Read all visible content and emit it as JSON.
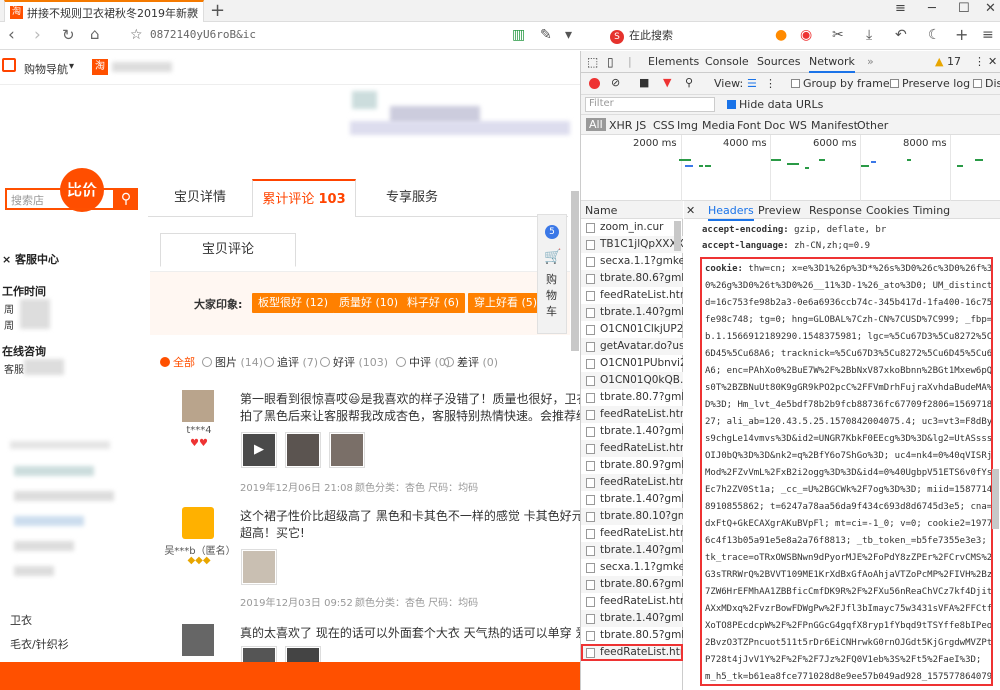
{
  "browser": {
    "tab_title": "拼接不规则卫衣裙秋冬2019年新款",
    "tab_close": "✕",
    "new_tab": "+",
    "url": "0872140yU6roB&ic",
    "search_engine_label": "在此搜索",
    "window_controls": [
      "≡",
      "─",
      "☐",
      "✕"
    ]
  },
  "shop": {
    "nav_label": "购物导航",
    "nav_arrow": "▾",
    "bijia": "比价",
    "search_placeholder": "搜索店",
    "side": {
      "service_center": "客服中心",
      "work_time": "工作时间",
      "work_time_line1": "周",
      "work_time_line2": "周",
      "online": "在线咨询",
      "online_sub": "客服",
      "cat_women": "卫衣",
      "cat_sweater": "毛衣/针织衫"
    },
    "tabs": [
      {
        "label": "宝贝详情",
        "count": ""
      },
      {
        "label": "累计评论",
        "count": "103"
      },
      {
        "label": "专享服务",
        "count": ""
      }
    ],
    "subtab": "宝贝评论",
    "impression_label": "大家印象:",
    "impression_tags": [
      "板型很好 (12)",
      "质量好 (10)",
      "料子好 (6)",
      "穿上好看 (5)"
    ],
    "filters": [
      {
        "label": "全部",
        "count": ""
      },
      {
        "label": "图片",
        "count": "(14)"
      },
      {
        "label": "追评",
        "count": "(7)"
      },
      {
        "label": "好评",
        "count": "(103)"
      },
      {
        "label": "中评",
        "count": "(0)"
      },
      {
        "label": "差评",
        "count": "(0)"
      }
    ],
    "reviews": [
      {
        "user": "t***4",
        "badge": "♥♥",
        "text": "第一眼看到很惊喜哎😃是我喜欢的样子没错了！质量也很好，卫衣",
        "text2": "拍了黑色后来让客服帮我改成杏色，客服特别热情快速。会推荐给",
        "date": "2019年12月06日 21:08",
        "attr": "颜色分类：杏色  尺码：均码"
      },
      {
        "user": "吴***b（匿名）",
        "badge": "◆◆◆",
        "text": "这个裙子性价比超级高了 黑色和卡其色不一样的感觉 卡其色好元气",
        "text2": "超高！买它!",
        "date": "2019年12月03日 09:52",
        "attr": "颜色分类：杏色  尺码：均码"
      },
      {
        "user": "",
        "badge": "",
        "text": "真的太喜欢了 现在的话可以外面套个大衣 天气热的话可以单穿 爱",
        "text2": "",
        "date": "",
        "attr": ""
      }
    ],
    "cart": {
      "count": "5",
      "label1": "购",
      "label2": "物",
      "label3": "车"
    }
  },
  "devtools": {
    "tabs": [
      "Elements",
      "Console",
      "Sources",
      "Network"
    ],
    "warning_count": "17",
    "toolbar": {
      "view_label": "View:",
      "group_by_frame": "Group by frame",
      "preserve_log": "Preserve log",
      "disable_cache": "Disal"
    },
    "filter_placeholder": "Filter",
    "hide_data_urls": "Hide data URLs",
    "types": [
      "All",
      "XHR",
      "JS",
      "CSS",
      "Img",
      "Media",
      "Font",
      "Doc",
      "WS",
      "Manifest",
      "Other"
    ],
    "timeline_ticks": [
      "2000 ms",
      "4000 ms",
      "6000 ms",
      "8000 ms"
    ],
    "name_header": "Name",
    "requests": [
      "zoom_in.cur",
      "TB1C1jlQpXXXX",
      "secxa.1.1?gmkey",
      "tbrate.80.6?gmk",
      "feedRateList.htm",
      "tbrate.1.40?gmk",
      "O1CN01ClkjUP2",
      "getAvatar.do?us",
      "O1CN01PUbnvi2",
      "O1CN01Q0kQB.",
      "tbrate.80.7?gmk",
      "feedRateList.htm",
      "tbrate.1.40?gmk",
      "feedRateList.htm",
      "tbrate.80.9?gmk",
      "feedRateList.htm",
      "tbrate.1.40?gmk",
      "tbrate.80.10?gm",
      "feedRateList.htm",
      "tbrate.1.40?gmk",
      "secxa.1.1?gmkey",
      "tbrate.80.6?gmk",
      "feedRateList.htm",
      "tbrate.1.40?gmk",
      "tbrate.80.5?gmk",
      "feedRateList.htm"
    ],
    "header_tabs": [
      "Headers",
      "Preview",
      "Response",
      "Cookies",
      "Timing"
    ],
    "headers": [
      {
        "key": "accept-encoding:",
        "value": "gzip, deflate, br"
      },
      {
        "key": "accept-language:",
        "value": "zh-CN,zh;q=0.9"
      }
    ],
    "cookie_key": "cookie:",
    "cookie_lines": [
      "thw=cn; x=e%3D1%26p%3D*%26s%3D0%26c%3D0%26f%3D",
      "0%26g%3D0%26t%3D0%26__11%3D-1%26_ato%3D0; UM_distincti",
      "d=16c753fe98b2a3-0e6a6936ccb74c-345b417d-1fa400-16c753",
      "fe98c748; tg=0; hng=GLOBAL%7Czh-CN%7CUSD%7C999; _fbp=f",
      "b.1.1566912189290.1548375981; lgc=%5Cu67D3%5Cu8272%5Cu",
      "6D45%5Cu68A6; tracknick=%5Cu67D3%5Cu8272%5Cu6D45%5Cu68",
      "A6; enc=PAhXo0%2BuE7W%2F%2BbNxV87xkoBbnn%2BGt1Mxew6pQP",
      "s0T%2BZBNuUt80K9gGR9kPO2pcC%2FFVmDrhFujraXvhdaBudeMA%3",
      "D%3D; Hm_lvt_4e5bdf78b2b9fcb88736fc67709f2806=15697182",
      "27; ali_ab=120.43.5.25.1570842004075.4; uc3=vt3=F8dByu",
      "s9chgLe14vmvs%3D&id2=UNGR7KbkF0EEcg%3D%3D&lg2=UtASsssm",
      "OIJ0bQ%3D%3D&nk2=q%2BfY6o7ShGo%3D; uc4=nk4=0%40qVISRjH",
      "Mod%2FZvVmL%2FxB2i2ogg%3D%3D&id4=0%40UgbpV51ETS6v0fYs",
      "Ec7h2ZV0St1a; _cc_=U%2BGCWk%2F7og%3D%3D; miid=15877140",
      "8910855862; t=6247a78aa56da9f434c693d8d6745d3e5; cna=gX",
      "dxFtQ+GkECAXgrAKuBVpFl; mt=ci=-1_0; v=0; cookie2=1977e",
      "6c4f13b05a91e5e8a2a76f8813; _tb_token_=b5fe7355e3e3;",
      "tk_trace=oTRxOWSBNwn9dPyorMJE%2FoPdY8zZPEr%2FCrvCMS%2B",
      "G3sTRRWrQ%2BVVT109ME1KrXdBxGfAoAhjaVTZoPcMP%2FIVH%2Bzm",
      "7ZW6HrEFMhAA1ZBBficCmfDK9R%2F%2FXu56nReaChVCz7kf4DjitO",
      "AXxMDxq%2FvzrBowFDWgPw%2FJfl3bImayc75w3431sVFA%2FFCtf",
      "XoTO8PEcdcpW%2F%2FPnGGcG4gqfX8ryp1fYbqd9tTSYffe8bIPeoQ%",
      "2BvzO3TZPncuot511t5rDr6EiCNHrwkG0rnOJGdt5KjGrgdwMVZPtR",
      "P728t4jJvV1Y%2F%2F%2F7Jz%2FQ0V1eb%3S%2Ft5%2FaeI%3D;",
      "m_h5_tk=b61ea8fce771028d8e9ee57b049ad928_157577864079"
    ]
  }
}
